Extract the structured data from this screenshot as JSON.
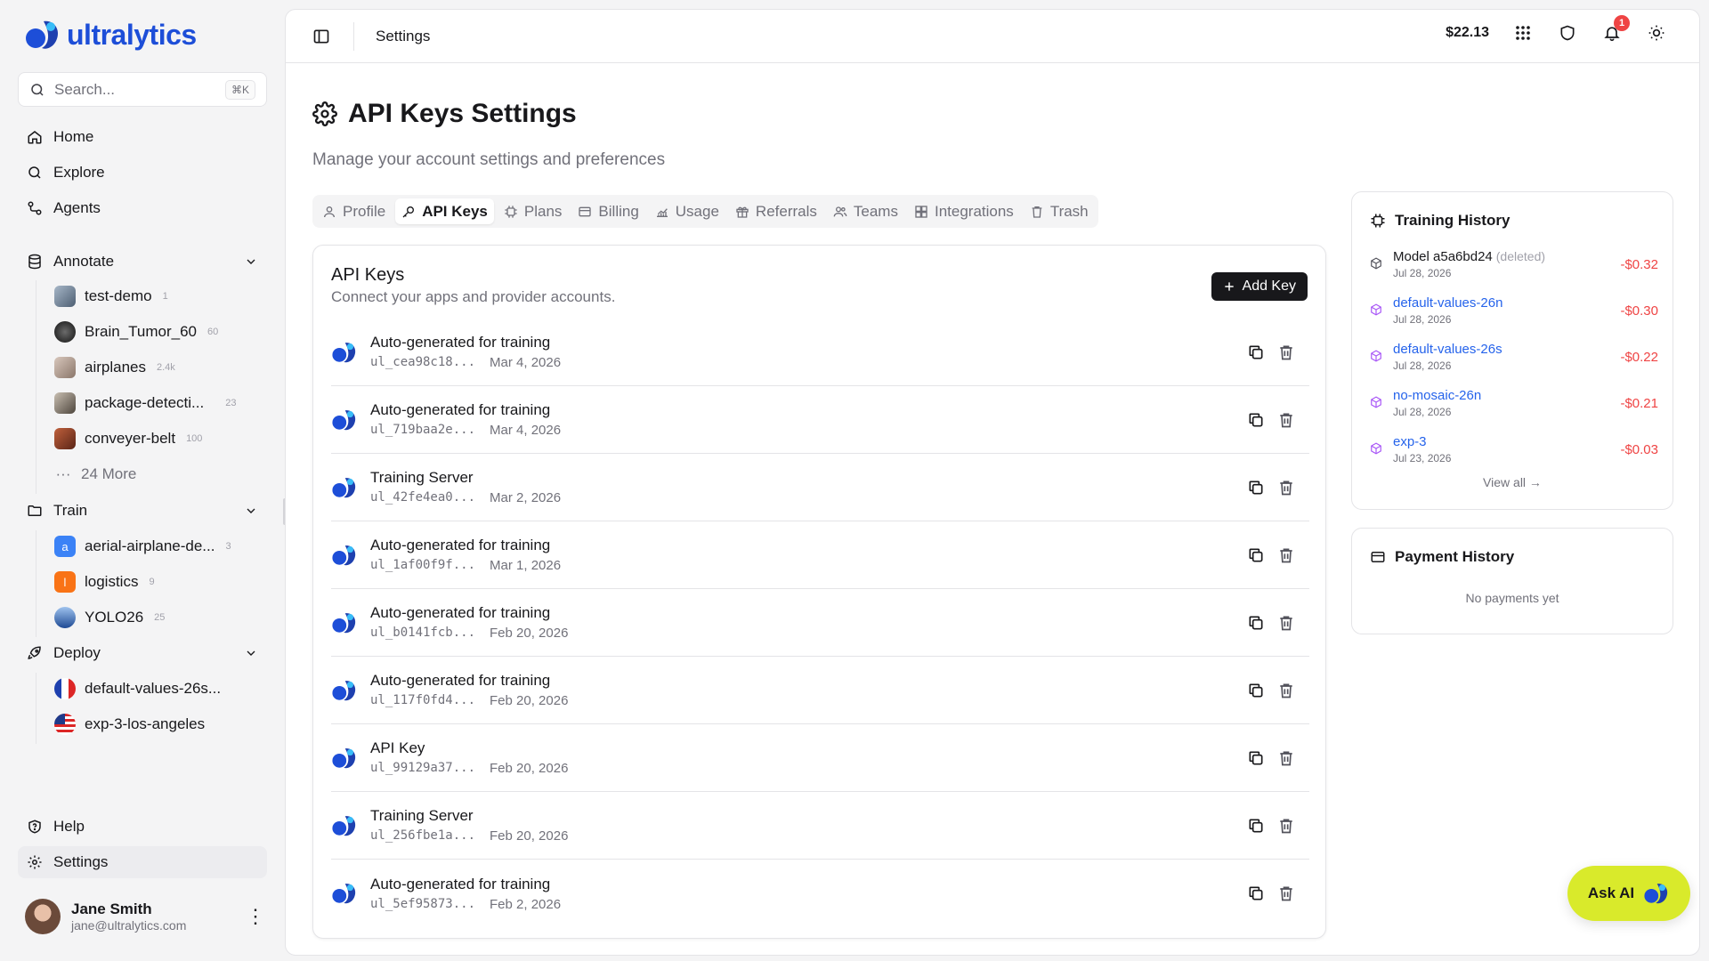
{
  "brand": {
    "name": "ultralytics",
    "colors": {
      "accent": "#1d4ed8",
      "ask_ai_bg": "#d9ea2b",
      "danger": "#ef4444",
      "link": "#2563eb"
    }
  },
  "search": {
    "placeholder": "Search...",
    "shortcut": "⌘K"
  },
  "nav": {
    "home": "Home",
    "explore": "Explore",
    "agents": "Agents",
    "annotate": "Annotate",
    "train": "Train",
    "deploy": "Deploy",
    "help": "Help",
    "settings": "Settings"
  },
  "annotate_items": [
    {
      "label": "test-demo",
      "count": "1",
      "color": "#7c8ea0"
    },
    {
      "label": "Brain_Tumor_60",
      "count": "60",
      "color": "#2b2b2b"
    },
    {
      "label": "airplanes",
      "count": "2.4k",
      "color": "#b8a59a"
    },
    {
      "label": "package-detecti...",
      "count": "23",
      "color": "#8a7f72"
    },
    {
      "label": "conveyer-belt",
      "count": "100",
      "color": "#a24a2e"
    }
  ],
  "annotate_more": "24 More",
  "train_items": [
    {
      "label": "aerial-airplane-de...",
      "count": "3",
      "letter": "a",
      "color": "#3b82f6"
    },
    {
      "label": "logistics",
      "count": "9",
      "letter": "l",
      "color": "#f97316"
    },
    {
      "label": "YOLO26",
      "count": "25",
      "letter": "",
      "color": "#2d5aa8"
    }
  ],
  "deploy_items": [
    {
      "label": "default-values-26s...",
      "flag": "fr-flag-icon"
    },
    {
      "label": "exp-3-los-angeles",
      "flag": "us-flag-icon"
    }
  ],
  "user": {
    "name": "Jane Smith",
    "email": "jane@ultralytics.com"
  },
  "topbar": {
    "title": "Settings",
    "balance": "$22.13",
    "notifications": "1"
  },
  "page": {
    "title": "API Keys Settings",
    "subtitle": "Manage your account settings and preferences"
  },
  "tabs": [
    {
      "label": "Profile",
      "icon": "user-icon"
    },
    {
      "label": "API Keys",
      "icon": "key-icon",
      "active": true
    },
    {
      "label": "Plans",
      "icon": "chip-icon"
    },
    {
      "label": "Billing",
      "icon": "card-icon"
    },
    {
      "label": "Usage",
      "icon": "chart-icon"
    },
    {
      "label": "Referrals",
      "icon": "gift-icon"
    },
    {
      "label": "Teams",
      "icon": "users-icon"
    },
    {
      "label": "Integrations",
      "icon": "puzzle-icon"
    },
    {
      "label": "Trash",
      "icon": "trash-icon"
    }
  ],
  "api_keys": {
    "title": "API Keys",
    "subtitle": "Connect your apps and provider accounts.",
    "add_label": "Add Key",
    "items": [
      {
        "name": "Auto-generated for training",
        "key": "ul_cea98c18...",
        "date": "Mar 4, 2026"
      },
      {
        "name": "Auto-generated for training",
        "key": "ul_719baa2e...",
        "date": "Mar 4, 2026"
      },
      {
        "name": "Training Server",
        "key": "ul_42fe4ea0...",
        "date": "Mar 2, 2026"
      },
      {
        "name": "Auto-generated for training",
        "key": "ul_1af00f9f...",
        "date": "Mar 1, 2026"
      },
      {
        "name": "Auto-generated for training",
        "key": "ul_b0141fcb...",
        "date": "Feb 20, 2026"
      },
      {
        "name": "Auto-generated for training",
        "key": "ul_117f0fd4...",
        "date": "Feb 20, 2026"
      },
      {
        "name": "API Key",
        "key": "ul_99129a37...",
        "date": "Feb 20, 2026"
      },
      {
        "name": "Training Server",
        "key": "ul_256fbe1a...",
        "date": "Feb 20, 2026"
      },
      {
        "name": "Auto-generated for training",
        "key": "ul_5ef95873...",
        "date": "Feb 2, 2026"
      }
    ]
  },
  "training_history": {
    "title": "Training History",
    "items": [
      {
        "name": "Model a5a6bd24",
        "deleted": "(deleted)",
        "date": "Jul 28, 2026",
        "amount": "-$0.32",
        "link": false
      },
      {
        "name": "default-values-26n",
        "deleted": "",
        "date": "Jul 28, 2026",
        "amount": "-$0.30",
        "link": true
      },
      {
        "name": "default-values-26s",
        "deleted": "",
        "date": "Jul 28, 2026",
        "amount": "-$0.22",
        "link": true
      },
      {
        "name": "no-mosaic-26n",
        "deleted": "",
        "date": "Jul 28, 2026",
        "amount": "-$0.21",
        "link": true
      },
      {
        "name": "exp-3",
        "deleted": "",
        "date": "Jul 23, 2026",
        "amount": "-$0.03",
        "link": true
      }
    ],
    "view_all": "View all →"
  },
  "payment_history": {
    "title": "Payment History",
    "empty": "No payments yet"
  },
  "ask_ai": {
    "label": "Ask AI"
  }
}
